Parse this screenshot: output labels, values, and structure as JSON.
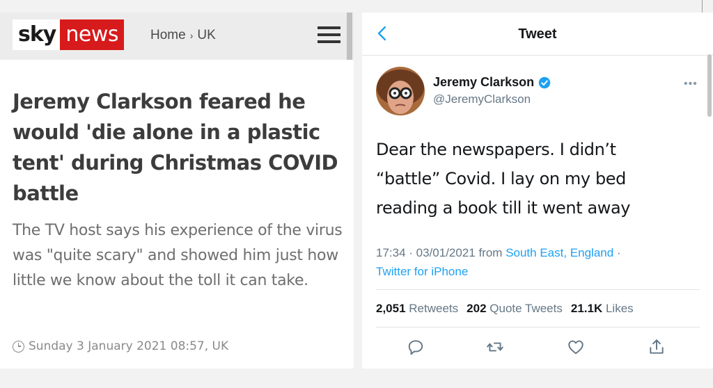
{
  "sky": {
    "logo_sky": "sky",
    "logo_news": "news",
    "breadcrumb": [
      "Home",
      "UK"
    ],
    "breadcrumb_sep": "›",
    "headline": "Jeremy Clarkson feared he would 'die alone in a plastic tent' during Christmas COVID battle",
    "summary": "The TV host says his experience of the virus was \"quite scary\" and showed him just how little we know about the toll it can take.",
    "date": "Sunday 3 January 2021 08:57, UK",
    "brand_color": "#d71a1b"
  },
  "tweet": {
    "header_title": "Tweet",
    "name": "Jeremy Clarkson",
    "handle": "@JeremyClarkson",
    "text": "Dear the newspapers. I didn’t “battle” Covid. I lay on my bed reading a book till it went away",
    "time": "17:34 · 03/01/2021 from ",
    "location": "South East, England",
    "location_sep": " ·",
    "source": "Twitter for iPhone",
    "stats": {
      "retweets_count": "2,051",
      "retweets_label": "Retweets",
      "quotes_count": "202",
      "quotes_label": "Quote Tweets",
      "likes_count": "21.1K",
      "likes_label": "Likes"
    },
    "icons": [
      "back-icon",
      "verified-icon",
      "more-icon",
      "reply-icon",
      "retweet-icon",
      "like-icon",
      "share-icon"
    ],
    "accent_color": "#1da1f2"
  }
}
